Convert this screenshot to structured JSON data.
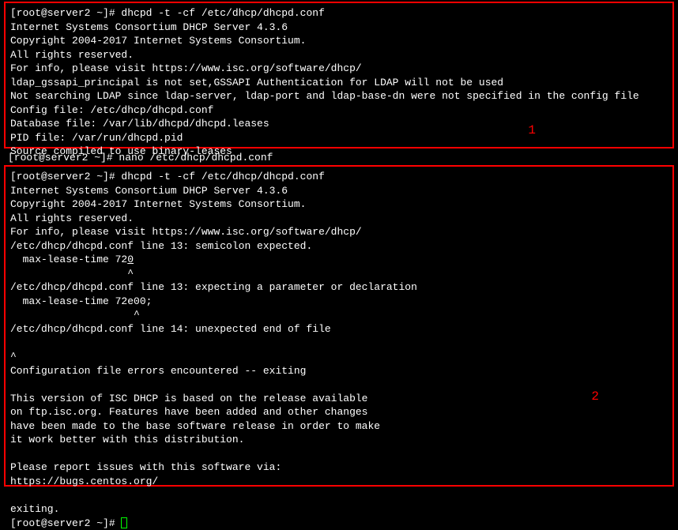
{
  "box1": {
    "prompt": "[root@server2 ~]# dhcpd -t -cf /etc/dhcp/dhcpd.conf",
    "line2": "Internet Systems Consortium DHCP Server 4.3.6",
    "line3": "Copyright 2004-2017 Internet Systems Consortium.",
    "line4": "All rights reserved.",
    "line5": "For info, please visit https://www.isc.org/software/dhcp/",
    "line6": "ldap_gssapi_principal is not set,GSSAPI Authentication for LDAP will not be used",
    "line7": "Not searching LDAP since ldap-server, ldap-port and ldap-base-dn were not specified in the config file",
    "line8": "Config file: /etc/dhcp/dhcpd.conf",
    "line9": "Database file: /var/lib/dhcpd/dhcpd.leases",
    "line10": "PID file: /var/run/dhcpd.pid",
    "line11": "Source compiled to use binary-leases"
  },
  "middle": {
    "line": "[root@server2 ~]# nano /etc/dhcp/dhcpd.conf"
  },
  "box2": {
    "prompt": "[root@server2 ~]# dhcpd -t -cf /etc/dhcp/dhcpd.conf",
    "line2": "Internet Systems Consortium DHCP Server 4.3.6",
    "line3": "Copyright 2004-2017 Internet Systems Consortium.",
    "line4": "All rights reserved.",
    "line5": "For info, please visit https://www.isc.org/software/dhcp/",
    "line6": "/etc/dhcp/dhcpd.conf line 13: semicolon expected.",
    "line7a": "  max-lease-time 72",
    "line7b": "0",
    "line8": "                   ^",
    "line9": "/etc/dhcp/dhcpd.conf line 13: expecting a parameter or declaration",
    "line10": "  max-lease-time 72e00;",
    "line11": "                    ^",
    "line12": "/etc/dhcp/dhcpd.conf line 14: unexpected end of file",
    "line13": "",
    "line14": "^",
    "line15": "Configuration file errors encountered -- exiting",
    "line16": "",
    "line17": "This version of ISC DHCP is based on the release available",
    "line18": "on ftp.isc.org. Features have been added and other changes",
    "line19": "have been made to the base software release in order to make",
    "line20": "it work better with this distribution.",
    "line21": "",
    "line22": "Please report issues with this software via:",
    "line23": "https://bugs.centos.org/",
    "line24": "",
    "line25": "exiting.",
    "line26": "[root@server2 ~]# "
  },
  "labels": {
    "one": "1",
    "two": "2"
  }
}
